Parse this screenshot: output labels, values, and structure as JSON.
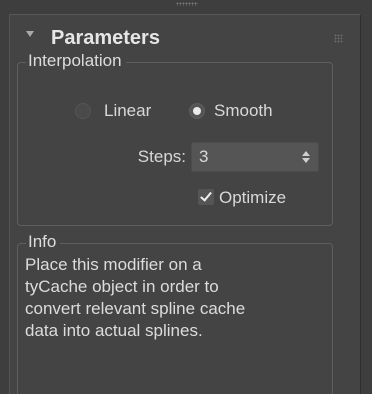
{
  "rollout": {
    "title": "Parameters"
  },
  "interpolation": {
    "group_label": "Interpolation",
    "options": [
      {
        "label": "Linear",
        "selected": false
      },
      {
        "label": "Smooth",
        "selected": true
      }
    ],
    "steps_label": "Steps:",
    "steps_value": "3",
    "optimize_label": "Optimize",
    "optimize_checked": true
  },
  "info": {
    "group_label": "Info",
    "lines": [
      "Place this modifier on a",
      "tyCache object in order to",
      "convert relevant spline cache",
      "data into actual splines."
    ]
  },
  "icons": {
    "collapse": "triangle-down-icon",
    "grip": "drag-grip-icon",
    "spinner": "spinner-arrows-icon",
    "check": "checkmark-icon"
  },
  "colors": {
    "background": "#3e3e3e",
    "panel": "#444444",
    "text": "#d8d8d8",
    "title": "#e6e6e6"
  }
}
